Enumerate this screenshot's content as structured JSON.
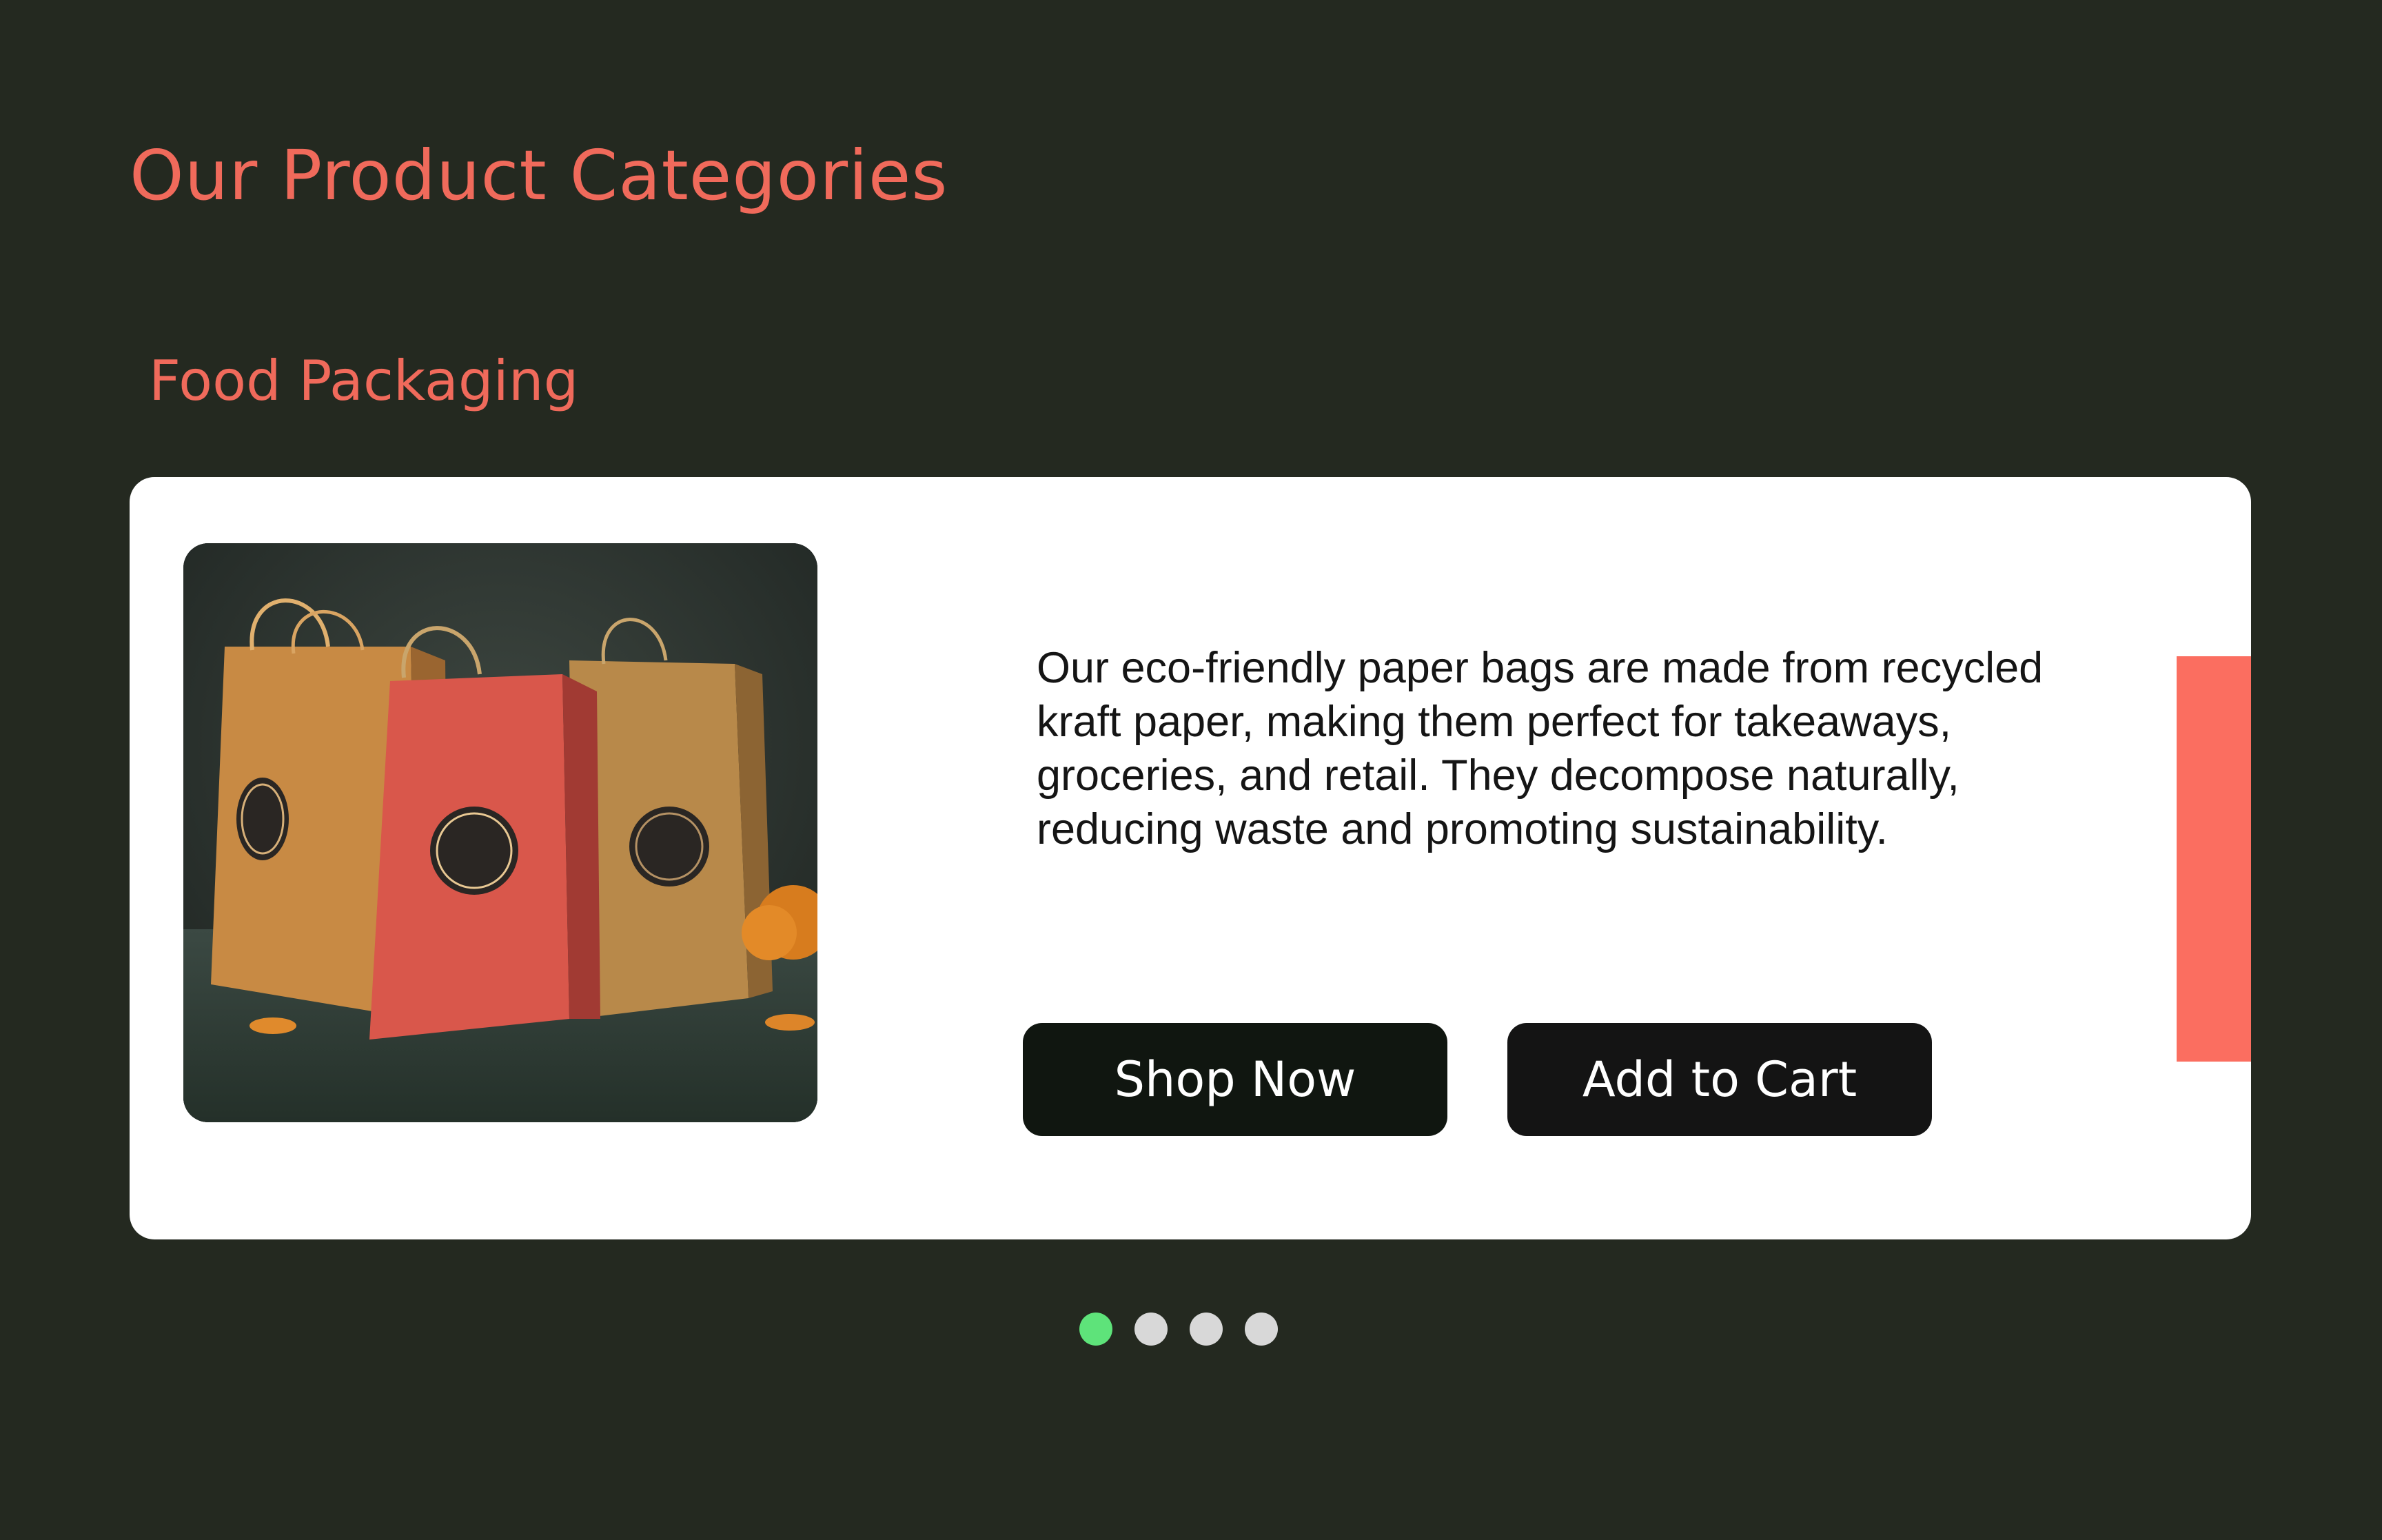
{
  "section": {
    "title": "Our Product Categories"
  },
  "category": {
    "title": "Food Packaging",
    "image_label": "Food packaging paper bags",
    "description": "Our eco-friendly paper bags are made from recycled kraft paper, making them perfect for takeaways, groceries, and retail. They decompose naturally, reducing waste and promoting sustainability."
  },
  "buttons": {
    "shop_now": "Shop Now",
    "add_to_cart": "Add to Cart"
  },
  "carousel": {
    "total_slides": 4,
    "active_index": 0
  },
  "colors": {
    "background": "#242920",
    "accent": "#f06a5b",
    "card": "#ffffff",
    "button_dark": "#101610",
    "active_dot": "#5ee37a",
    "inactive_dot": "#d8d8d8"
  }
}
